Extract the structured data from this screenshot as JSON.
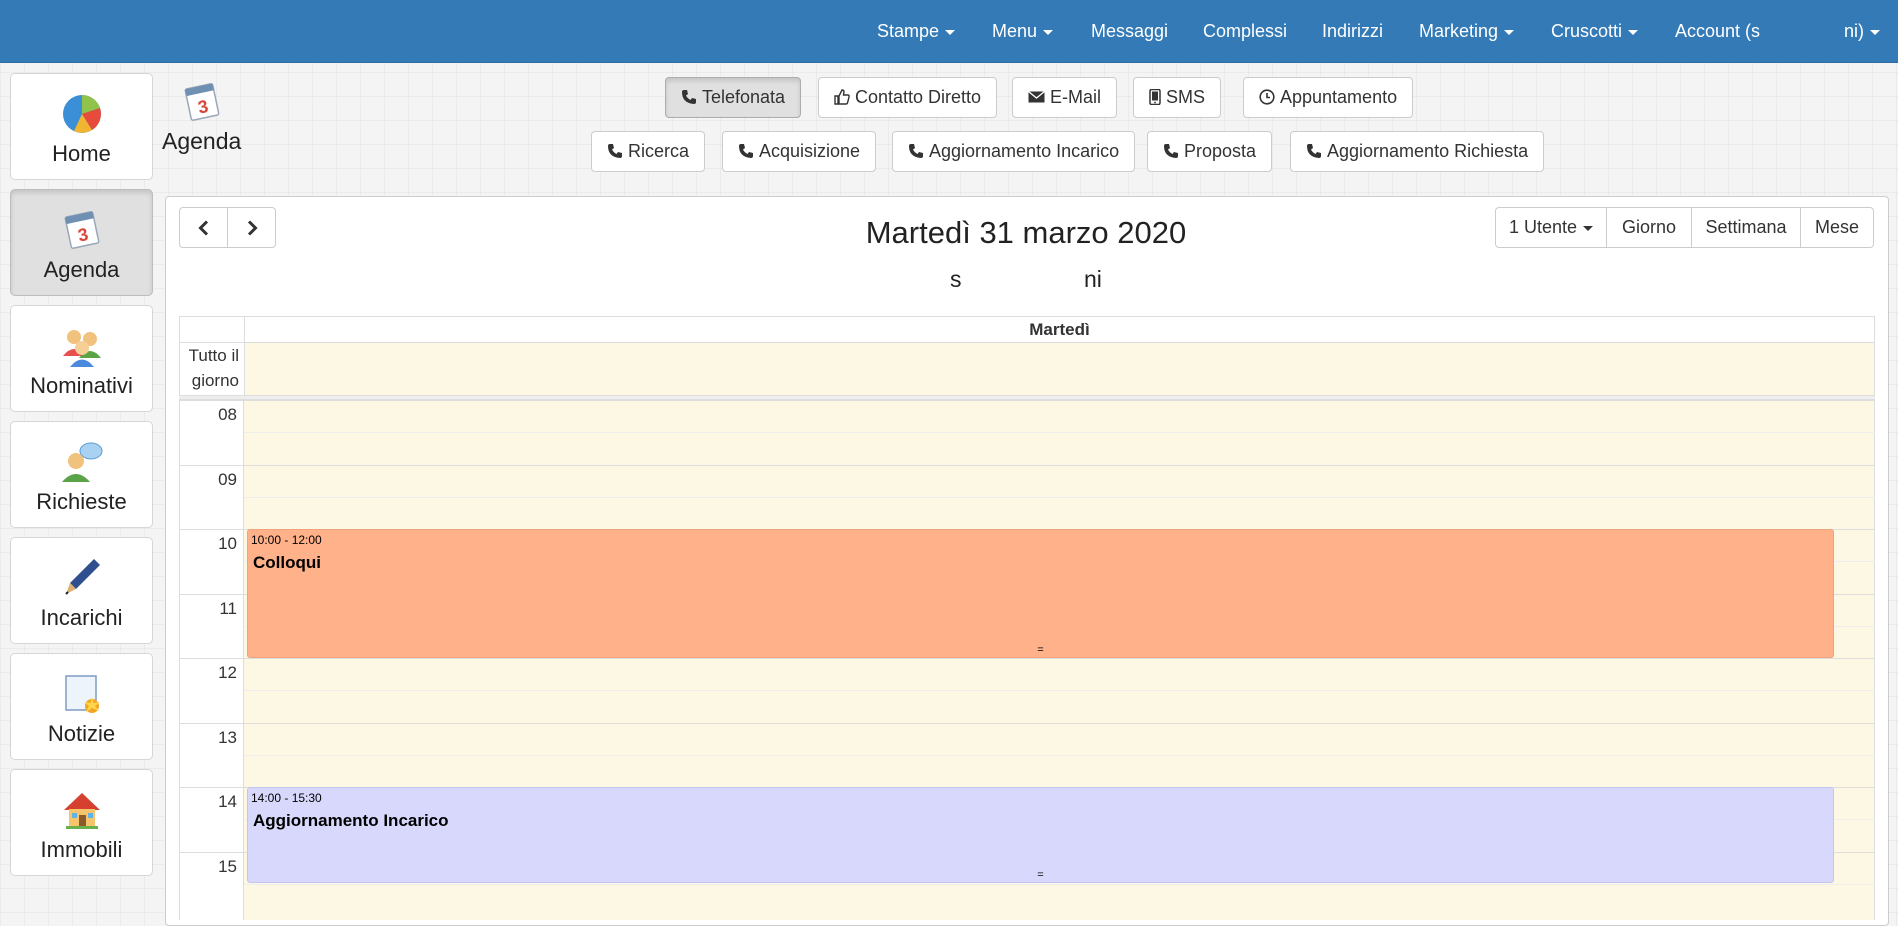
{
  "navbar": {
    "items": [
      {
        "label": "Stampe",
        "dropdown": true
      },
      {
        "label": "Menu",
        "dropdown": true
      },
      {
        "label": "Messaggi",
        "dropdown": false
      },
      {
        "label": "Complessi",
        "dropdown": false
      },
      {
        "label": "Indirizzi",
        "dropdown": false
      },
      {
        "label": "Marketing",
        "dropdown": true
      },
      {
        "label": "Cruscotti",
        "dropdown": true
      },
      {
        "label": "Account (s",
        "dropdown": false
      },
      {
        "label": "ni)",
        "dropdown": true
      }
    ]
  },
  "sidebar": {
    "items": [
      {
        "label": "Home",
        "icon": "pie-chart-icon",
        "active": false
      },
      {
        "label": "Agenda",
        "icon": "calendar-icon",
        "active": true
      },
      {
        "label": "Nominativi",
        "icon": "users-icon",
        "active": false
      },
      {
        "label": "Richieste",
        "icon": "user-chat-icon",
        "active": false
      },
      {
        "label": "Incarichi",
        "icon": "pen-icon",
        "active": false
      },
      {
        "label": "Notizie",
        "icon": "news-icon",
        "active": false
      },
      {
        "label": "Immobili",
        "icon": "house-icon",
        "active": false
      }
    ]
  },
  "page": {
    "title": "Agenda",
    "title_icon": "calendar-icon",
    "calendar_icon_number": "3"
  },
  "actions": {
    "row1": [
      {
        "label": "Telefonata",
        "icon": "phone-icon",
        "active": true
      },
      {
        "label": "Contatto Diretto",
        "icon": "thumbs-up-icon",
        "active": false
      },
      {
        "label": "E-Mail",
        "icon": "envelope-icon",
        "active": false
      },
      {
        "label": "SMS",
        "icon": "mobile-icon",
        "active": false
      },
      {
        "label": "Appuntamento",
        "icon": "clock-icon",
        "active": false
      }
    ],
    "row2": [
      {
        "label": "Ricerca",
        "icon": "phone-icon"
      },
      {
        "label": "Acquisizione",
        "icon": "phone-icon"
      },
      {
        "label": "Aggiornamento Incarico",
        "icon": "phone-icon"
      },
      {
        "label": "Proposta",
        "icon": "phone-icon"
      },
      {
        "label": "Aggiornamento Richiesta",
        "icon": "phone-icon"
      }
    ]
  },
  "calendar": {
    "date_title": "Martedì 31 marzo 2020",
    "subtitle_left": "s",
    "subtitle_right": "ni",
    "views": [
      "1 Utente",
      "Giorno",
      "Settimana",
      "Mese"
    ],
    "day_header": "Martedì",
    "allday_label": "Tutto il giorno",
    "hours": [
      "08",
      "09",
      "10",
      "11",
      "12",
      "13",
      "14",
      "15"
    ],
    "events": [
      {
        "time": "10:00 - 12:00",
        "title": "Colloqui",
        "color": "#ffb18a",
        "resize_handle": "="
      },
      {
        "time": "14:00 - 15:30",
        "title": "Aggiornamento Incarico",
        "color": "#d8d8fc",
        "resize_handle": "="
      }
    ]
  },
  "colors": {
    "navbar": "#337ab7",
    "calendar_bg": "#fcf8e3"
  }
}
